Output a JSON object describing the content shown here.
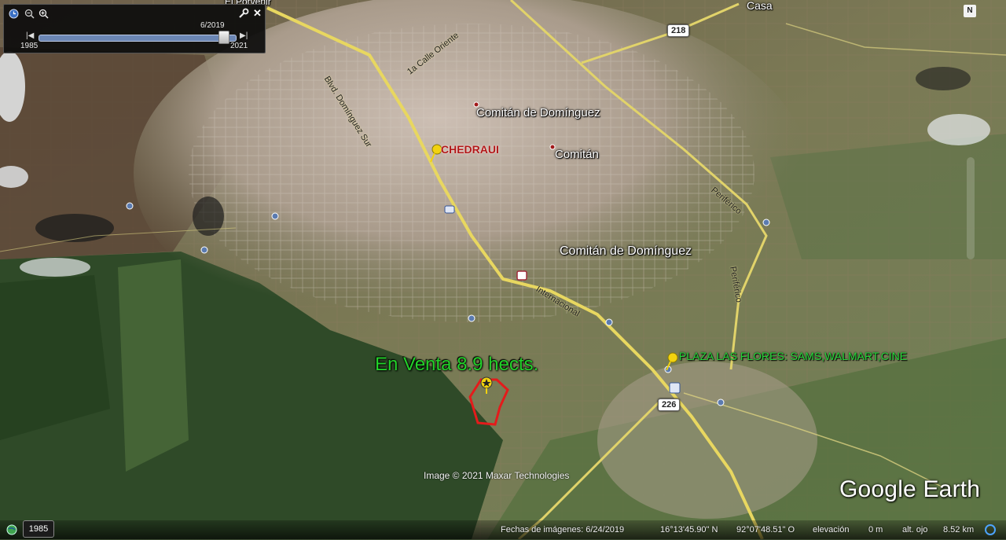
{
  "history_panel": {
    "date_label": "6/2019",
    "start_year": "1985",
    "end_year": "2021",
    "slider_position_fraction": 0.94
  },
  "places": {
    "comitan_de_dominguez_top": "Comitán de Domínguez",
    "comitan": "Comitán",
    "comitan_de_dominguez_center": "Comitán de Domínguez",
    "el_porvenir": "El Porvenir",
    "casa": "Casa"
  },
  "roads": {
    "blvd_dominguez": "Blvd. Domínguez Sur",
    "oriente": "1a Calle Oriente",
    "periferico_1": "Periférico",
    "periferico_2": "Periférico",
    "internacional": "Internacional"
  },
  "shields": {
    "h218": "218",
    "h226": "226"
  },
  "placemarks": {
    "chedraui": "CHEDRAUI",
    "plaza": "PLAZA LAS FLORES: SAMS,WALMART,CINE",
    "sale": "En Venta 8.9 hects."
  },
  "attribution": "Image © 2021 Maxar Technologies",
  "logo": "Google Earth",
  "status_bar": {
    "year_badge": "1985",
    "imagery_date": "Fechas de imágenes: 6/24/2019",
    "latitude": "16°13'45.90\" N",
    "longitude": "92°07'48.51\" O",
    "elevation_label": "elevación",
    "elevation_value": "0 m",
    "eye_alt_label": "alt. ojo",
    "eye_alt_value": "8.52 km"
  },
  "colors": {
    "sale_label": "#23d12a",
    "sale_boundary": "#e41b1b",
    "chedraui_label": "#b01818",
    "plaza_label": "#26d63a",
    "pushpin": "#f2d20f",
    "main_road": "#e8d760"
  },
  "icons": [
    "clock-icon",
    "zoom-out-icon",
    "zoom-in-icon",
    "wrench-icon",
    "close-icon",
    "pushpin-icon",
    "star-marker-icon",
    "north-arrow-icon",
    "compass-icon"
  ]
}
